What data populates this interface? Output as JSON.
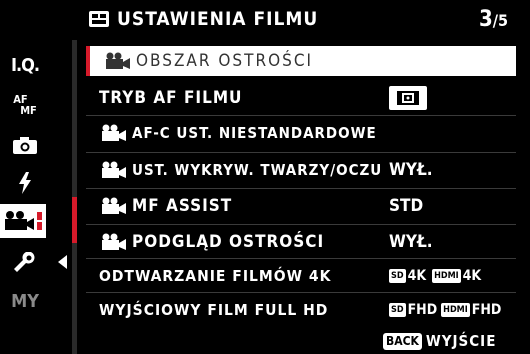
{
  "header": {
    "title": "USTAWIENIA FILMU",
    "page": "3",
    "total": "/5",
    "icon": "movie-settings-icon"
  },
  "sidebar": {
    "items": [
      {
        "label": "I.Q.",
        "icon": "image-quality-icon"
      },
      {
        "label": "AF",
        "label2": "MF",
        "icon": "af-mf-icon"
      },
      {
        "label": "",
        "icon": "camera-icon"
      },
      {
        "label": "",
        "icon": "flash-icon"
      },
      {
        "label": "",
        "icon": "movie-icon"
      },
      {
        "label": "",
        "icon": "wrench-icon"
      },
      {
        "label": "MY",
        "icon": "my-menu-icon"
      }
    ]
  },
  "menu": {
    "rows": [
      {
        "label": "OBSZAR OSTROŚCI",
        "value": ""
      },
      {
        "label": "TRYB AF FILMU",
        "value": ""
      },
      {
        "label": "AF-C UST. NIESTANDARDOWE",
        "value": ""
      },
      {
        "label": "UST. WYKRYW. TWARZY/OCZU",
        "value": "WYŁ."
      },
      {
        "label": "MF ASSIST",
        "value": "STD"
      },
      {
        "label": "PODGLĄD OSTROŚCI",
        "value": "WYŁ."
      },
      {
        "label": "ODTWARZANIE FILMÓW 4K",
        "value": "",
        "badge1": "SD",
        "fmt1": "4K",
        "badge2": "HDMI",
        "fmt2": "4K"
      },
      {
        "label": "WYJŚCIOWY FILM FULL HD",
        "value": "",
        "badge1": "SD",
        "fmt1": "FHD",
        "badge2": "HDMI",
        "fmt2": "FHD"
      }
    ]
  },
  "footer": {
    "back": "BACK",
    "exit": "WYJŚCIE"
  },
  "colors": {
    "accent": "#d61a2a",
    "background": "#000000",
    "selected_bg": "#ffffff"
  }
}
